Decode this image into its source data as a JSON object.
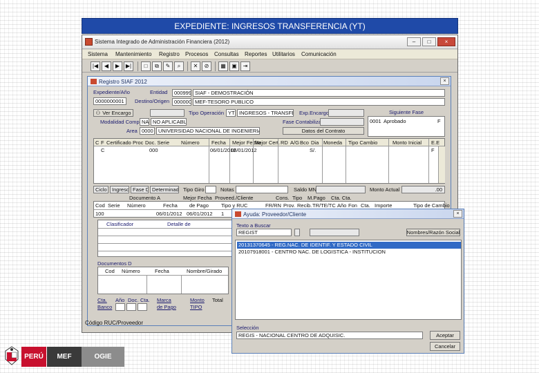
{
  "slide_title": "EXPEDIENTE: INGRESOS TRANSFERENCIA (YT)",
  "app": {
    "title": "Sistema Integrado de Administración Financiera (2012)",
    "window_buttons": {
      "minimize": "–",
      "maximize": "□",
      "close": "×"
    },
    "menu": [
      "Sistema",
      "Mantenimiento",
      "Registro",
      "Procesos",
      "Consultas",
      "Reportes",
      "Utilitarios",
      "Comunicación"
    ],
    "toolbar_icons": [
      "first-icon",
      "prev-icon",
      "next-icon",
      "last-icon",
      "new-icon",
      "copy-icon",
      "edit-icon",
      "search-icon",
      "delete-icon",
      "cancel-icon",
      "calc-icon",
      "save-icon",
      "exit-icon"
    ],
    "status": {
      "label": "Código RUC/Proveedor"
    }
  },
  "registro": {
    "title": "Registro SIAF 2012",
    "expediente": {
      "label": "Expediente/Año",
      "value": "0000000001"
    },
    "entidad": {
      "label": "Entidad",
      "code": "000999",
      "name": "SIAF - DEMOSTRACIÓN"
    },
    "destino": {
      "label": "Destino/Origen",
      "code": "000000",
      "name": "MEF-TESORO PUBLICO"
    },
    "ver_encargo": "Ver Encargo",
    "tipo_operacion": {
      "label": "Tipo Operación",
      "code": "YT",
      "name": "INGRESOS - TRANSFER"
    },
    "exp_encargo": {
      "label": "Exp.Encargo"
    },
    "modalidad": {
      "label": "Modalidad Compra",
      "code": "NA",
      "name": "NO APLICABLE"
    },
    "fase_contabilizar": {
      "label": "Fase Contabilizar"
    },
    "area": {
      "label": "Area",
      "code": "0000",
      "name": "UNIVERSIDAD NACIONAL DE INGENIERIA"
    },
    "datos_contrato": "Datos del Contrato",
    "siguiente_fase": {
      "label": "Siguiente Fase",
      "code": "0001",
      "name": "Aprobado"
    },
    "fase_grid": {
      "headers": [
        "C",
        "F",
        "Certificado",
        "Proc",
        "Doc. Serie",
        "Número",
        "Fecha",
        "Mejor Fecha",
        "Mejor Cert.",
        "RD",
        "A/G",
        "Bco",
        "Dia",
        "Moneda",
        "Tipo Cambio",
        "Monto Inicial",
        "E.E"
      ],
      "row": {
        "c": "C",
        "f": "F",
        "certificado": "000",
        "fecha": "06/01/2012",
        "mejor_fecha": "06/01/2012",
        "moneda": "S/.",
        "ee": "F"
      },
      "right_list": [
        "0001 Aprobado"
      ]
    },
    "estado_bar": {
      "ciclo": "Ciclo I",
      "ciclo_val": "Ingreso",
      "fase": "Fase D",
      "fase_val": "Determinado",
      "tipo_giro": "Tipo Giro",
      "notas": "Notas",
      "saldo_mn": "Saldo MN",
      "monto_actual": "Monto Actual",
      "monto_actual_val": ".00"
    },
    "documento": {
      "headers_top": [
        "Documento A",
        "Mejor Fecha",
        "Proveed./Cliente",
        "Cons.",
        "Tipo",
        "M.Pago",
        "Cta. Cta."
      ],
      "headers": [
        "Cod",
        "Serie",
        "Número",
        "Fecha",
        "de Pago",
        "Tipo y RUC",
        "FR/RN",
        "Prov.",
        "Recib.",
        "TR/TE/TC",
        "Año",
        "Fon",
        "Cta.",
        "Importe",
        "Tipo de Cambio"
      ],
      "row": {
        "cod": "100",
        "fecha": "06/01/2012",
        "mejor_fecha": "06/01/2012",
        "tipo": "1"
      }
    },
    "clasificador": {
      "label": "Clasificador",
      "detalle": "Detalle de"
    },
    "documentos_d": {
      "label": "Documentos D",
      "headers": [
        "Cod",
        "Número",
        "Fecha",
        "Nombre/Girado"
      ]
    },
    "bottom_labels": [
      "Cta.",
      "Año",
      "Doc.",
      "Cta.",
      "Marca",
      "Monto",
      "Total"
    ],
    "bottom_labels2": [
      "Banco",
      "de Pago",
      "TIPO"
    ]
  },
  "ayuda": {
    "title": "Ayuda: Proveedor/Cliente",
    "texto_buscar": "Texto a Buscar",
    "buscar_value": "REGIST",
    "modo": "Nombres/Razón Social",
    "list": [
      "20131370645 - REG.NAC. DE IDENTIF. Y ESTADO CIVIL",
      "20107918001 - CENTRO NAC. DE LOGISTICA - INSTITUCION"
    ],
    "seleccion_label": "Selección",
    "seleccion_value": "REGIS - NACIONAL CENTRO DE ADQUISIC.",
    "aceptar": "Aceptar",
    "cancelar": "Cancelar"
  },
  "footer": {
    "peru": "PERÚ",
    "mef": "MEF",
    "ogie": "OGIE",
    "colors": {
      "peru": "#c8102e",
      "mef": "#3a3a3a",
      "ogie": "#8c8c8c"
    }
  }
}
